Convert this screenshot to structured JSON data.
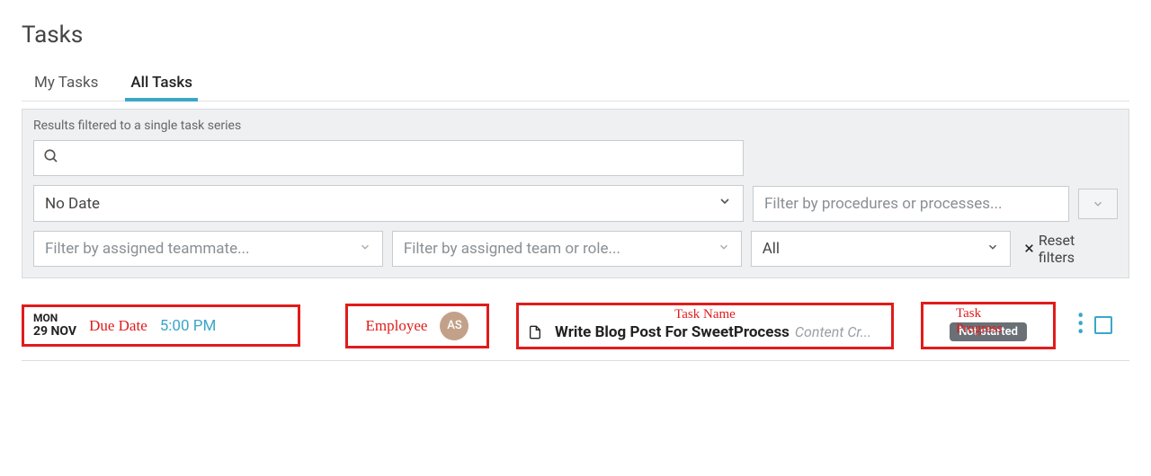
{
  "page_title": "Tasks",
  "tabs": {
    "my": "My Tasks",
    "all": "All Tasks"
  },
  "filters": {
    "note": "Results filtered to a single task series",
    "search_placeholder": "",
    "date": "No Date",
    "procedure_placeholder": "Filter by procedures or processes...",
    "teammate_placeholder": "Filter by assigned teammate...",
    "team_placeholder": "Filter by assigned team or role...",
    "status": "All",
    "reset": "Reset filters"
  },
  "annotations": {
    "due_date": "Due Date",
    "employee": "Employee",
    "task_name": "Task Name",
    "task_progress": "Task Progress"
  },
  "task": {
    "day": "MON",
    "date": "29 NOV",
    "time": "5:00 PM",
    "assignee_initials": "AS",
    "name": "Write Blog Post For SweetProcess",
    "category": "Content Cr...",
    "status": "Not started"
  }
}
